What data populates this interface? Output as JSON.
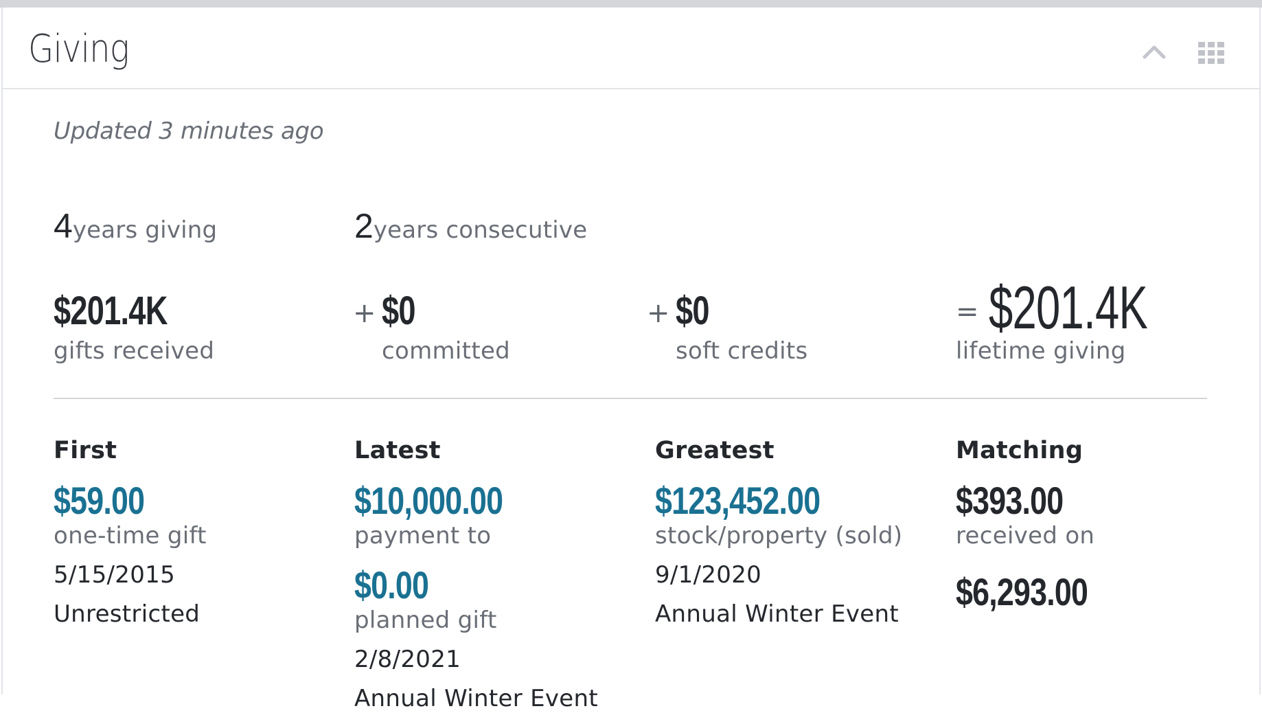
{
  "header": {
    "title": "Giving",
    "collapse_icon": "chevron-up-icon",
    "menu_icon": "grid-icon"
  },
  "updated": "Updated 3 minutes ago",
  "years": {
    "giving_num": "4",
    "giving_label": "years giving",
    "consecutive_num": "2",
    "consecutive_label": "years consecutive"
  },
  "summary": {
    "gifts_received": {
      "amount": "$201.4K",
      "label": "gifts received"
    },
    "committed": {
      "operator": "+",
      "amount": "$0",
      "label": "committed"
    },
    "soft_credits": {
      "operator": "+",
      "amount": "$0",
      "label": "soft credits"
    },
    "lifetime": {
      "operator": "=",
      "amount": "$201.4K",
      "label": "lifetime giving"
    }
  },
  "first": {
    "heading": "First",
    "amount": "$59.00",
    "type": "one-time gift",
    "date": "5/15/2015",
    "fund": "Unrestricted"
  },
  "latest": {
    "heading": "Latest",
    "amount": "$10,000.00",
    "type": "payment to",
    "amount2": "$0.00",
    "type2": "planned gift",
    "date": "2/8/2021",
    "fund": "Annual Winter Event"
  },
  "greatest": {
    "heading": "Greatest",
    "amount": "$123,452.00",
    "type": "stock/property (sold)",
    "date": "9/1/2020",
    "fund": "Annual Winter Event"
  },
  "matching": {
    "heading": "Matching",
    "amount": "$393.00",
    "label": "received on",
    "amount2": "$6,293.00"
  },
  "colors": {
    "link": "#1a7192",
    "text": "#24272c",
    "muted": "#6a6e76"
  }
}
